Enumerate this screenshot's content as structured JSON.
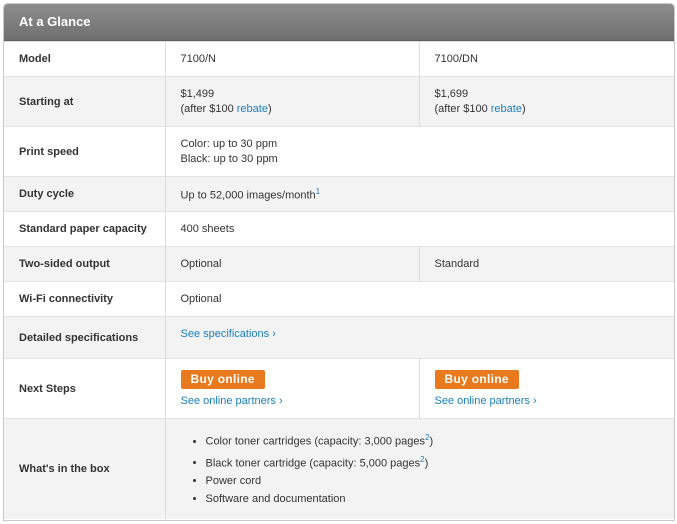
{
  "header": {
    "title": "At a Glance"
  },
  "rows": {
    "model": {
      "label": "Model",
      "col1": "7100/N",
      "col2": "7100/DN"
    },
    "starting": {
      "label": "Starting at",
      "col1_price": "$1,499",
      "col1_pre": "(after $100 ",
      "col1_link": "rebate",
      "col1_post": ")",
      "col2_price": "$1,699",
      "col2_pre": "(after $100 ",
      "col2_link": "rebate",
      "col2_post": ")"
    },
    "print_speed": {
      "label": "Print speed",
      "line1": "Color: up to 30 ppm",
      "line2": "Black: up to 30 ppm"
    },
    "duty_cycle": {
      "label": "Duty cycle",
      "value": "Up to 52,000 images/month",
      "footnote": "1"
    },
    "paper_capacity": {
      "label": "Standard paper capacity",
      "value": "400 sheets"
    },
    "two_sided": {
      "label": "Two-sided output",
      "col1": "Optional",
      "col2": "Standard"
    },
    "wifi": {
      "label": "Wi-Fi connectivity",
      "value": "Optional"
    },
    "specs": {
      "label": "Detailed specifications",
      "link": "See specifications ›"
    },
    "next_steps": {
      "label": "Next Steps",
      "col1_button": "Buy online",
      "col1_link": "See online partners ›",
      "col2_button": "Buy online",
      "col2_link": "See online partners ›"
    },
    "in_box": {
      "label": "What's in the box",
      "item1_text": "Color toner cartridges (capacity: 3,000 pages",
      "item1_note": "2",
      "item1_end": ")",
      "item2_text": "Black toner cartridge (capacity: 5,000 pages",
      "item2_note": "2",
      "item2_end": ")",
      "item3_text": "Power cord",
      "item4_text": "Software and documentation"
    }
  },
  "colors": {
    "header_bg": "#7a7a7a",
    "button": "#e87a1d",
    "link": "#1a7fc0",
    "stripe": "#f3f3f3"
  }
}
